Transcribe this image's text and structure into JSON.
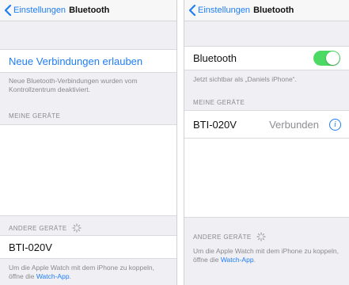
{
  "colors": {
    "accent": "#1f7ef5",
    "toggle_on": "#4cd964",
    "background": "#efeff4"
  },
  "left_screen": {
    "nav": {
      "back_label": "Einstellungen",
      "title": "Bluetooth"
    },
    "new_connections": {
      "label": "Neue Verbindungen erlauben"
    },
    "new_connections_footer": "Neue Bluetooth-Verbindungen wurden vom Kontrollzentrum deaktiviert.",
    "my_devices_header": "MEINE GERÄTE",
    "other_devices_header": "ANDERE GERÄTE",
    "other_devices": [
      {
        "name": "BTI-020V"
      }
    ],
    "watch_footer": {
      "text": "Um die Apple Watch mit dem iPhone zu koppeln, öffne die ",
      "link": "Watch-App",
      "end": "."
    }
  },
  "right_screen": {
    "nav": {
      "back_label": "Einstellungen",
      "title": "Bluetooth"
    },
    "bluetooth_row": {
      "label": "Bluetooth",
      "toggle_on": true
    },
    "visible_as": "Jetzt sichtbar als „Daniels iPhone“.",
    "my_devices_header": "MEINE GERÄTE",
    "my_devices": [
      {
        "name": "BTI-020V",
        "status": "Verbunden"
      }
    ],
    "other_devices_header": "ANDERE GERÄTE",
    "watch_footer": {
      "text": "Um die Apple Watch mit dem iPhone zu koppeln, öffne die ",
      "link": "Watch-App",
      "end": "."
    }
  }
}
